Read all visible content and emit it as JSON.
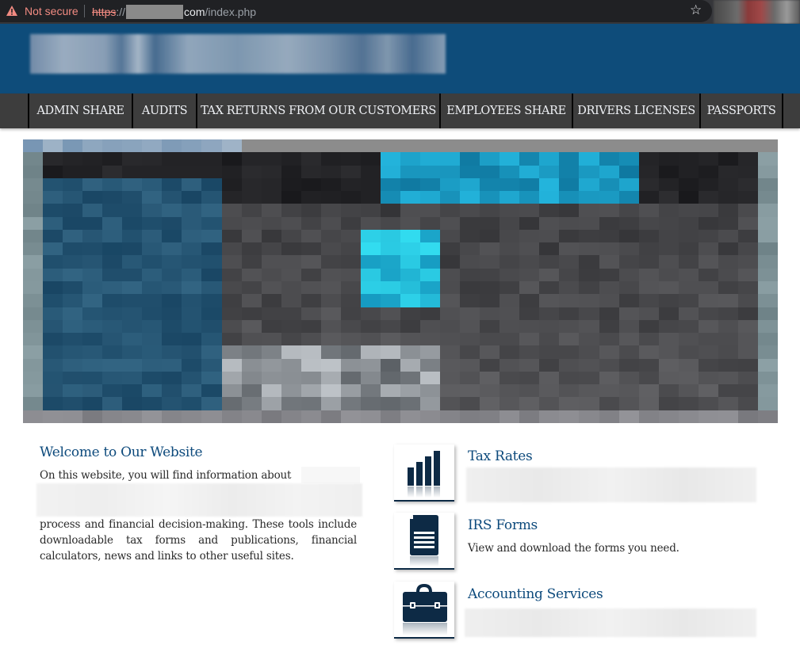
{
  "browser": {
    "security_label": "Not secure",
    "url_scheme": "https",
    "url_separator": "://",
    "url_host_suffix": "com",
    "url_path": "/index.php",
    "icons": {
      "warning": "warning-triangle-icon",
      "bookmark": "star-icon"
    }
  },
  "header": {
    "logo_text_redacted": true
  },
  "nav": {
    "items": [
      {
        "label": "ADMIN SHARE"
      },
      {
        "label": "AUDITS"
      },
      {
        "label": "TAX RETURNS FROM OUR CUSTOMERS"
      },
      {
        "label": "EMPLOYEES SHARE"
      },
      {
        "label": "DRIVERS LICENSES"
      },
      {
        "label": "PASSPORTS"
      }
    ]
  },
  "hero": {
    "image_redacted": true
  },
  "welcome": {
    "title": "Welcome to Our Website",
    "line1": "On this website, you will find information about",
    "paragraph": "process and financial decision-making. These tools include downloadable tax forms and publications, financial calculators, news and links to other useful sites."
  },
  "services": [
    {
      "title": "Tax Rates",
      "description": "",
      "icon": "bar-chart-icon",
      "description_redacted": true
    },
    {
      "title": "IRS Forms",
      "description": "View and download the forms you need.",
      "icon": "document-icon",
      "description_redacted": false
    },
    {
      "title": "Accounting Services",
      "description": "",
      "icon": "briefcase-icon",
      "description_redacted": true
    }
  ],
  "colors": {
    "header_blue": "#0e4c7a",
    "nav_gray": "#3d3d3d",
    "title_blue": "#0d4a7c",
    "icon_navy": "#0d2a45",
    "not_secure_red": "#f28b82"
  }
}
